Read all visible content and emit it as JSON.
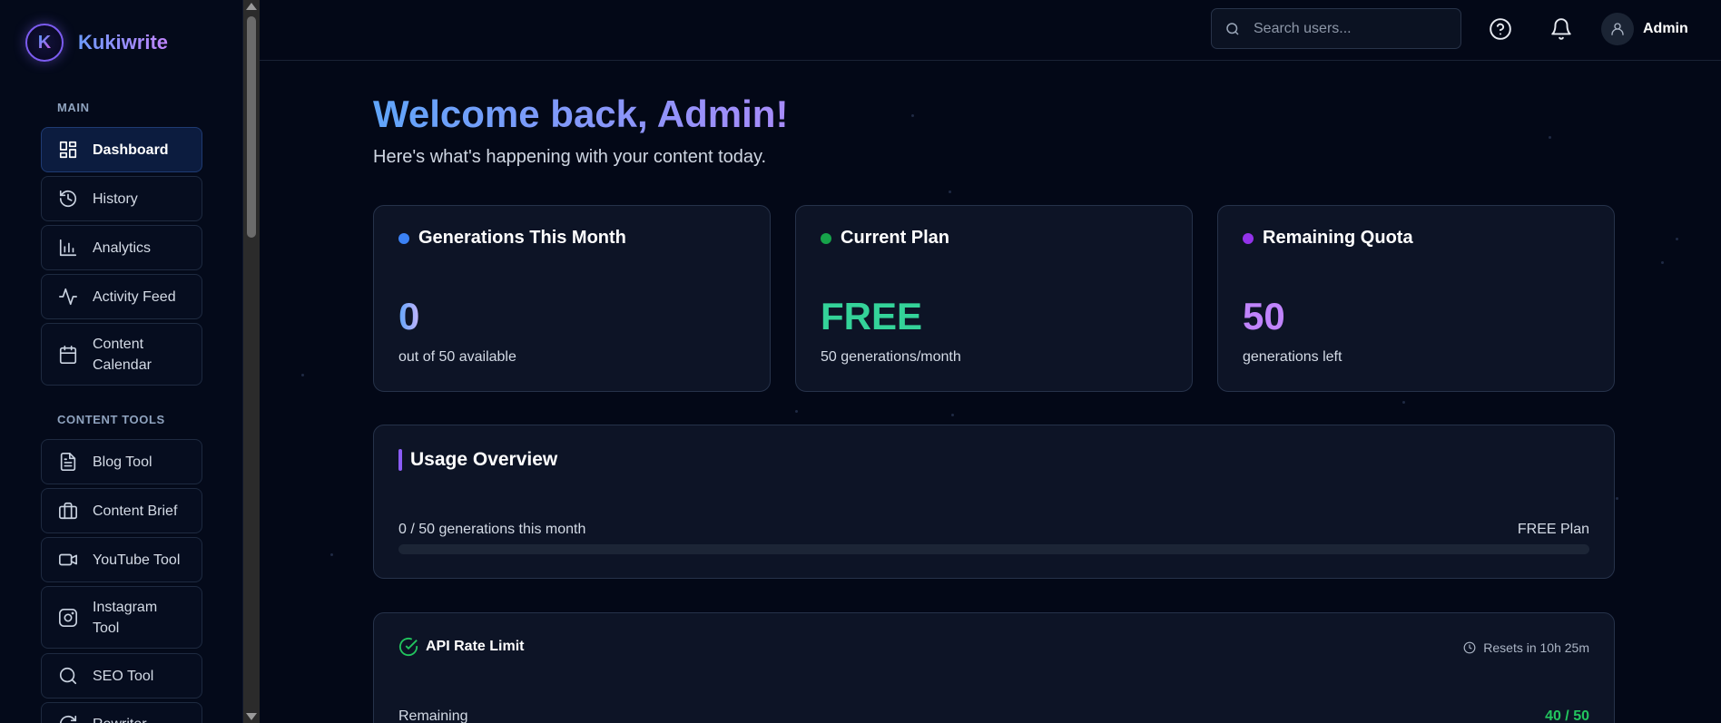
{
  "brand": {
    "logo_letter": "K",
    "name": "Kukiwrite"
  },
  "sidebar": {
    "main_label": "MAIN",
    "main_items": [
      {
        "label": "Dashboard",
        "icon": "dashboard-icon",
        "active": true
      },
      {
        "label": "History",
        "icon": "history-icon"
      },
      {
        "label": "Analytics",
        "icon": "analytics-icon"
      },
      {
        "label": "Activity Feed",
        "icon": "activity-icon"
      },
      {
        "label": "Content Calendar",
        "icon": "calendar-icon"
      }
    ],
    "tools_label": "CONTENT TOOLS",
    "tool_items": [
      {
        "label": "Blog Tool",
        "icon": "document-icon"
      },
      {
        "label": "Content Brief",
        "icon": "briefcase-icon"
      },
      {
        "label": "YouTube Tool",
        "icon": "video-icon"
      },
      {
        "label": "Instagram Tool",
        "icon": "instagram-icon"
      },
      {
        "label": "SEO Tool",
        "icon": "search-icon"
      },
      {
        "label": "Rewriter",
        "icon": "refresh-icon"
      }
    ]
  },
  "topbar": {
    "search_placeholder": "Search users...",
    "help_icon": "help-icon",
    "bell_icon": "bell-icon",
    "user_name": "Admin"
  },
  "main": {
    "welcome": "Welcome back, Admin!",
    "subtitle": "Here's what's happening with your content today.",
    "stats": [
      {
        "title": "Generations This Month",
        "value": "0",
        "sub": "out of 50 available",
        "dot_color": "#3b82f6",
        "value_color": "#93c5fd"
      },
      {
        "title": "Current Plan",
        "value": "FREE",
        "sub": "50 generations/month",
        "dot_color": "#16a34a",
        "value_color": "#34d399"
      },
      {
        "title": "Remaining Quota",
        "value": "50",
        "sub": "generations left",
        "dot_color": "#9333ea",
        "value_color": "#c084fc"
      }
    ],
    "usage": {
      "title": "Usage Overview",
      "left": "0 / 50 generations this month",
      "right": "FREE Plan",
      "progress": 0
    },
    "api": {
      "title": "API Rate Limit",
      "reset": "Resets in 10h 25m",
      "remaining_label": "Remaining",
      "count": "40 / 50"
    }
  },
  "colors": {
    "background": "#030817",
    "card": "#0d1426",
    "accent": "#8b5cf6",
    "success": "#22c55e"
  }
}
